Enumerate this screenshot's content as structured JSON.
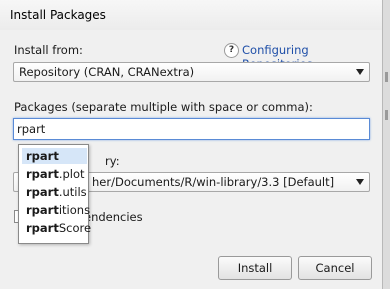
{
  "window": {
    "title": "Install Packages"
  },
  "install_from": {
    "label": "Install from:",
    "help_icon": "question-icon",
    "help_glyph": "?",
    "link_label": "Configuring Repositories",
    "selected": "Repository (CRAN, CRANextra)"
  },
  "packages": {
    "label": "Packages (separate multiple with space or comma):",
    "value": "rpart"
  },
  "autocomplete": {
    "items": [
      {
        "match": "rpart",
        "rest": ""
      },
      {
        "match": "rpart",
        "rest": ".plot"
      },
      {
        "match": "rpart",
        "rest": ".utils"
      },
      {
        "match": "rpart",
        "rest": "itions"
      },
      {
        "match": "rpart",
        "rest": "Score"
      }
    ]
  },
  "library": {
    "label_fragment": "ry:",
    "selected_fragment": "her/Documents/R/win-library/3.3 [Default]"
  },
  "dependencies": {
    "label_fragment": "endencies"
  },
  "buttons": {
    "install": "Install",
    "cancel": "Cancel"
  },
  "colors": {
    "link": "#1f4fa8",
    "focus": "#5a8bd6",
    "selection": "#d6e6f8"
  }
}
